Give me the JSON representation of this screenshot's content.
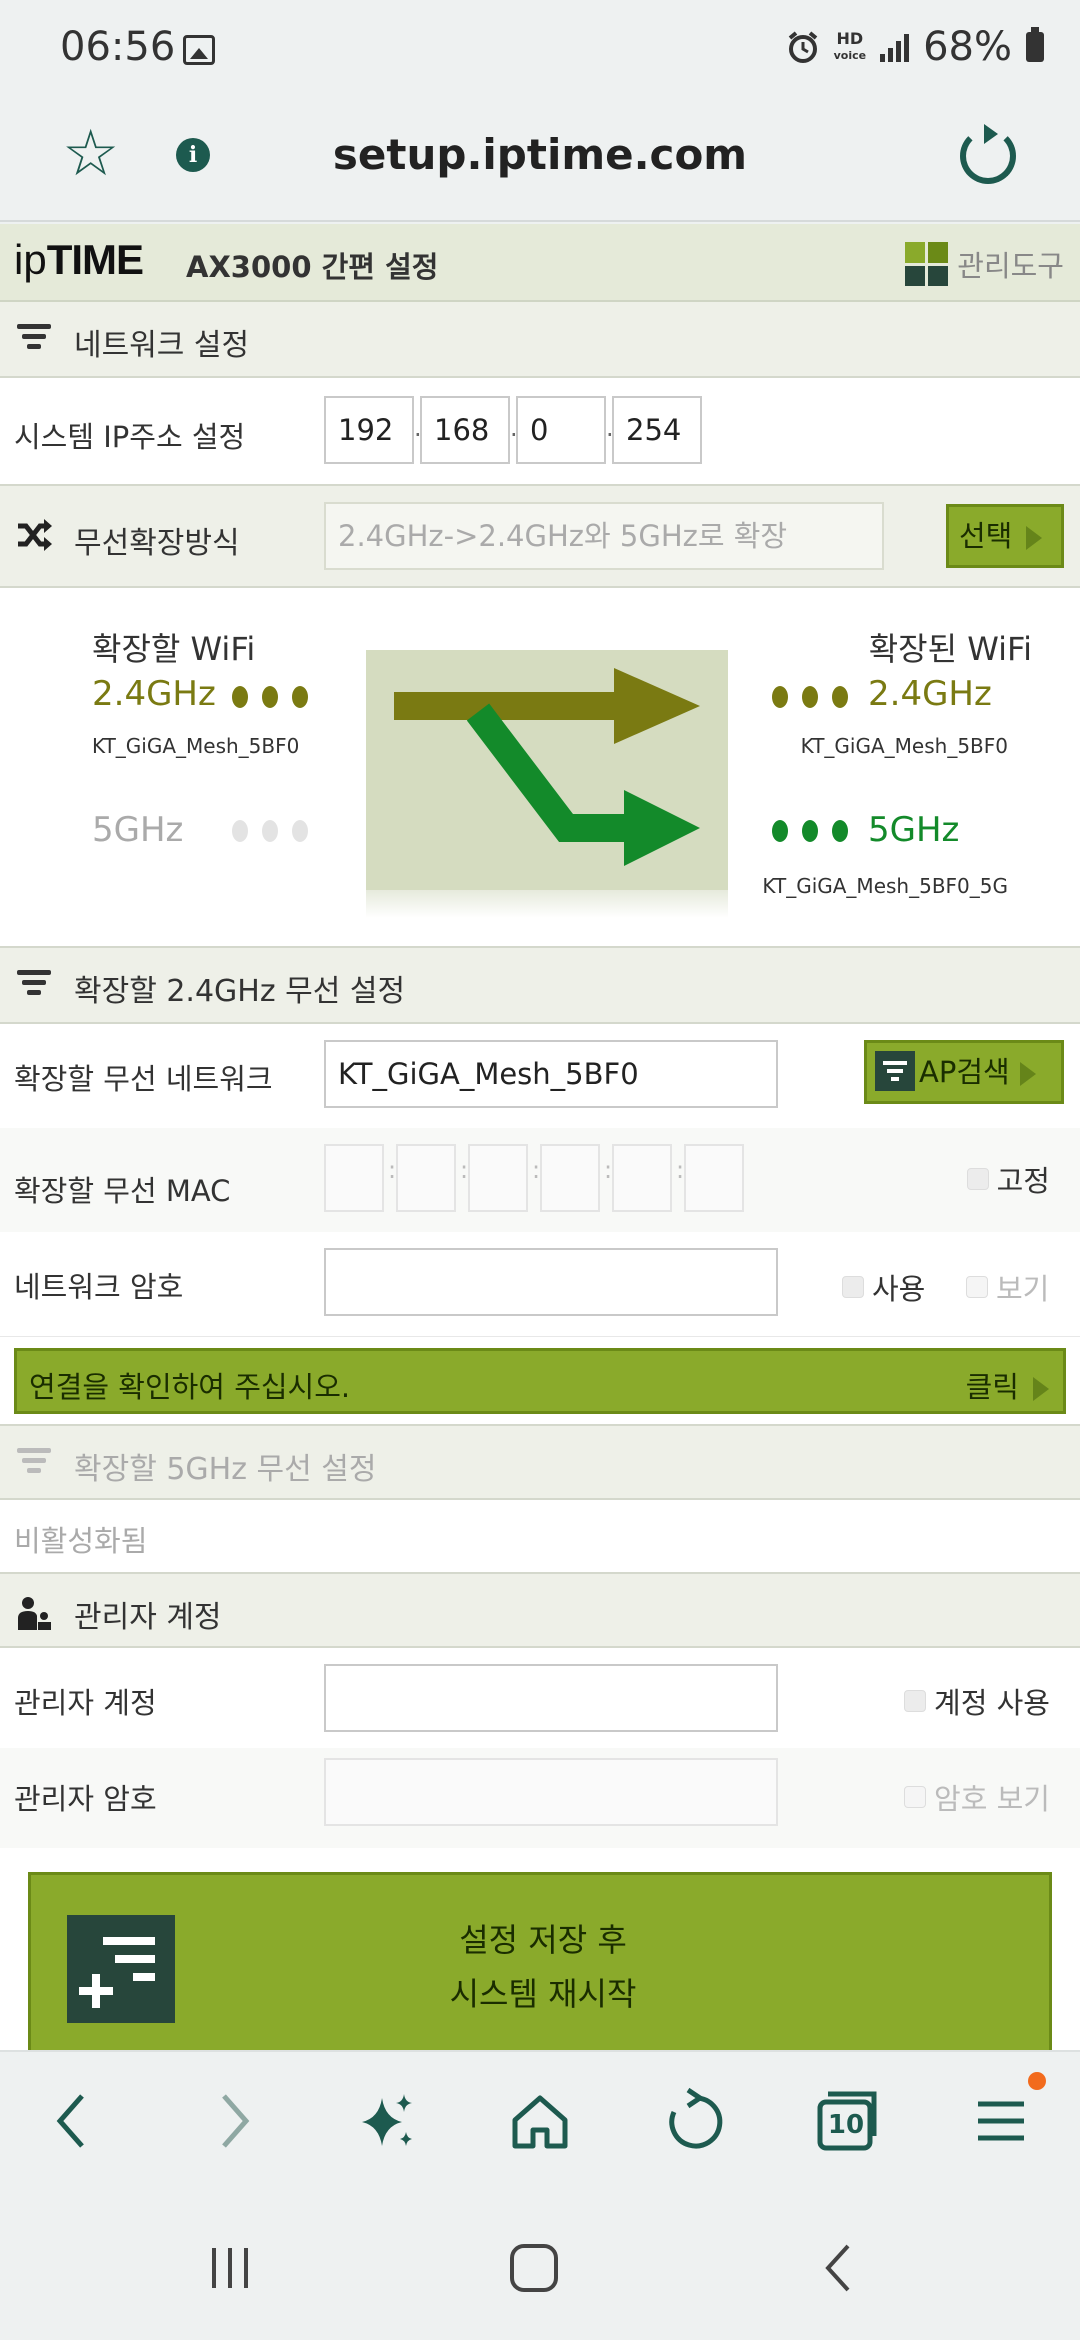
{
  "status": {
    "time": "06:56",
    "hd": "HD",
    "voice": "voice",
    "battery": "68%"
  },
  "urlbar": {
    "url": "setup.iptime.com"
  },
  "app": {
    "logo_ip": "ip",
    "logo_time": "TIME",
    "title": "AX3000 간편 설정",
    "admin_tools": "관리도구"
  },
  "network": {
    "section": "네트워크 설정",
    "ip_label": "시스템 IP주소 설정",
    "ip": [
      "192",
      "168",
      "0",
      "254"
    ]
  },
  "wireless_ext": {
    "section": "무선확장방식",
    "method": "2.4GHz->2.4GHz와 5GHz로 확장",
    "select": "선택",
    "source_title": "확장할 WiFi",
    "target_title": "확장된 WiFi",
    "band24": "2.4GHz",
    "band5": "5GHz",
    "source_ssid": "KT_GiGA_Mesh_5BF0",
    "target_ssid_24": "KT_GiGA_Mesh_5BF0",
    "target_ssid_5": "KT_GiGA_Mesh_5BF0_5G",
    "olive": "#7a7a12",
    "green": "#138a2a",
    "grey": "#b8b8b8"
  },
  "ext24": {
    "section": "확장할 2.4GHz 무선 설정",
    "network_label": "확장할 무선 네트워크",
    "network_value": "KT_GiGA_Mesh_5BF0",
    "ap_search": "AP검색",
    "mac_label": "확장할 무선 MAC",
    "fixed": "고정",
    "pw_label": "네트워크 암호",
    "use": "사용",
    "show": "보기",
    "notice": "연결을 확인하여 주십시오.",
    "click": "클릭"
  },
  "ext5": {
    "section": "확장할 5GHz 무선 설정",
    "status": "비활성화됨"
  },
  "admin": {
    "section": "관리자 계정",
    "account_label": "관리자 계정",
    "account_use": "계정 사용",
    "pw_label": "관리자 암호",
    "pw_show": "암호 보기"
  },
  "save": {
    "line1": "설정 저장 후",
    "line2": "시스템 재시작"
  },
  "toolbar": {
    "tabs_count": "10"
  },
  "colors": {
    "accent": "#8aaa2b",
    "brand_dark": "#1d5a4f",
    "badge": "#f26b1d"
  }
}
